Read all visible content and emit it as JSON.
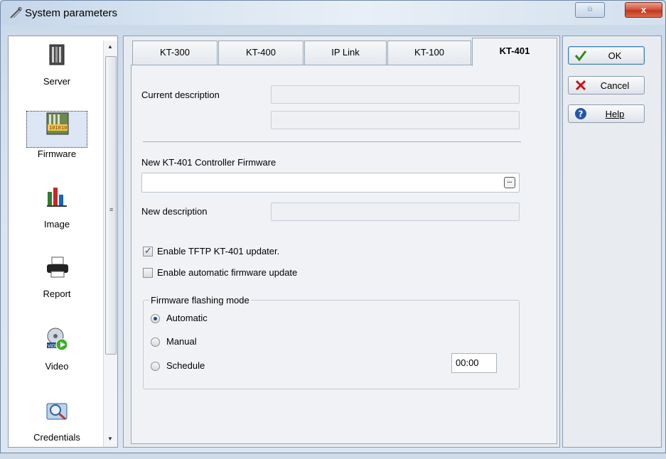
{
  "window": {
    "title": "System parameters",
    "restore_glyph": "⧉",
    "close_glyph": "x"
  },
  "sidebar": {
    "items": [
      {
        "label": "Server",
        "icon": "server-icon"
      },
      {
        "label": "Firmware",
        "icon": "firmware-icon",
        "selected": true
      },
      {
        "label": "Image",
        "icon": "chart-icon"
      },
      {
        "label": "Report",
        "icon": "printer-icon"
      },
      {
        "label": "Video",
        "icon": "video-icon"
      },
      {
        "label": "Credentials",
        "icon": "credentials-icon"
      }
    ]
  },
  "tabs": [
    {
      "label": "KT-300"
    },
    {
      "label": "KT-400"
    },
    {
      "label": "IP Link"
    },
    {
      "label": "KT-100"
    },
    {
      "label": "KT-401",
      "active": true
    }
  ],
  "form": {
    "current_description_label": "Current description",
    "current_description_1": "",
    "current_description_2": "",
    "new_firmware_label": "New KT-401 Controller Firmware",
    "new_firmware_value": "",
    "browse_button": "...",
    "new_description_label": "New description",
    "new_description_value": "",
    "enable_tftp_label": "Enable TFTP KT-401 updater.",
    "enable_tftp_checked": true,
    "enable_auto_update_label": "Enable automatic firmware update",
    "enable_auto_update_checked": false,
    "flashing_mode": {
      "title": "Firmware flashing mode",
      "options": [
        "Automatic",
        "Manual",
        "Schedule"
      ],
      "selected": "Automatic",
      "schedule_time": "00:00"
    }
  },
  "buttons": {
    "ok": "OK",
    "cancel": "Cancel",
    "help": "Help"
  },
  "colors": {
    "ok_check": "#2e8b1e",
    "cancel_x": "#cc1111",
    "help_circle": "#2255aa"
  }
}
